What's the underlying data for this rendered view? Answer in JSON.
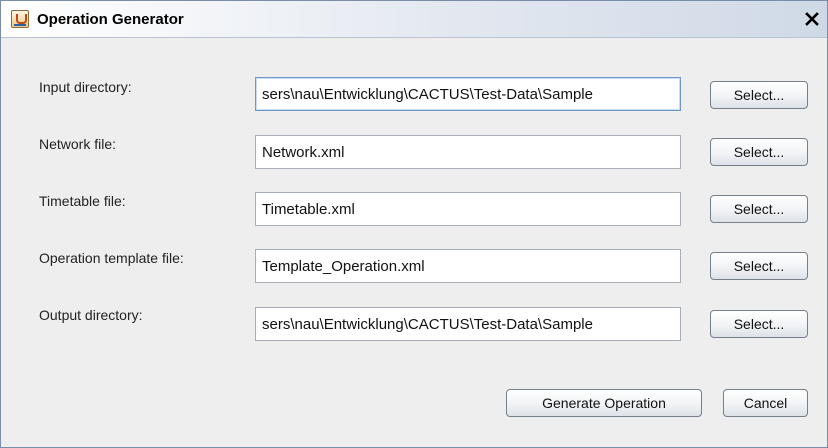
{
  "window": {
    "title": "Operation Generator",
    "app_icon": "java-cup-icon",
    "close_glyph": "✕"
  },
  "form": {
    "rows": [
      {
        "label": "Input directory:",
        "value": "sers\\nau\\Entwicklung\\CACTUS\\Test-Data\\Sample",
        "button": "Select..."
      },
      {
        "label": "Network file:",
        "value": "Network.xml",
        "button": "Select..."
      },
      {
        "label": "Timetable file:",
        "value": "Timetable.xml",
        "button": "Select..."
      },
      {
        "label": "Operation template file:",
        "value": "Template_Operation.xml",
        "button": "Select..."
      },
      {
        "label": "Output directory:",
        "value": "sers\\nau\\Entwicklung\\CACTUS\\Test-Data\\Sample",
        "button": "Select..."
      }
    ]
  },
  "actions": {
    "generate_label": "Generate Operation",
    "cancel_label": "Cancel"
  }
}
